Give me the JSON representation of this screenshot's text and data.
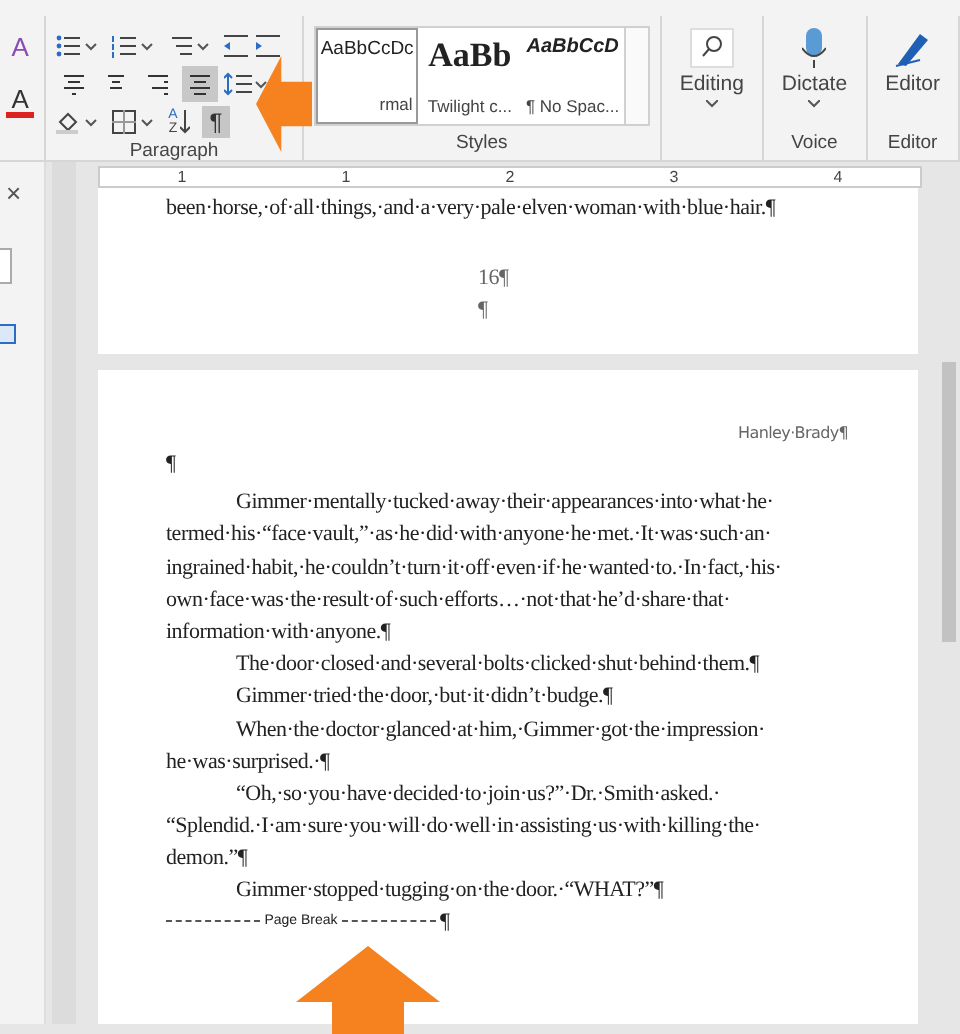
{
  "font_group": {
    "text_effects": "A",
    "font_color": "A"
  },
  "paragraph": {
    "label": "Paragraph",
    "sort": [
      "A",
      "Z"
    ],
    "alignment": [
      {
        "selected": false
      },
      {
        "selected": false
      },
      {
        "selected": false
      },
      {
        "selected": true
      }
    ],
    "show_marks": {
      "label": "¶",
      "selected": true
    }
  },
  "styles": {
    "label": "Styles",
    "items": [
      {
        "preview": "AaBbCcDc",
        "name": "rmal",
        "kind": "normal"
      },
      {
        "preview": "AaBb",
        "name": "Twilight c...",
        "kind": "title"
      },
      {
        "preview": "AaBbCcD",
        "name": "¶ No Spac...",
        "kind": "emphasis"
      }
    ]
  },
  "editing": {
    "label": "Editing"
  },
  "voice": {
    "button": "Dictate",
    "label": "Voice"
  },
  "editor": {
    "button": "Editor",
    "label": "Editor"
  },
  "side_pane": {
    "close": "×",
    "checked": true
  },
  "ruler": {
    "numbers": [
      "1",
      "1",
      "2",
      "3",
      "4"
    ]
  },
  "page_one": [
    {
      "kind": "body",
      "text": "been·horse,·of·all·things,·and·a·very·pale·elven·woman·with·blue·hair.¶"
    },
    {
      "kind": "gap"
    },
    {
      "kind": "center",
      "text": "16¶"
    },
    {
      "kind": "center",
      "text": "¶"
    }
  ],
  "page_two": {
    "header": "Hanley·Brady¶",
    "lines": [
      {
        "kind": "body",
        "text": "¶"
      },
      {
        "kind": "space"
      },
      {
        "kind": "indent",
        "text": "Gimmer·mentally·tucked·away·their·appearances·into·what·he·"
      },
      {
        "kind": "body",
        "text": "termed·his·“face·vault,”·as·he·did·with·anyone·he·met.·It·was·such·an·"
      },
      {
        "kind": "body",
        "text": "ingrained·habit,·he·couldn’t·turn·it·off·even·if·he·wanted·to.·In·fact,·his·"
      },
      {
        "kind": "body",
        "text": "own·face·was·the·result·of·such·efforts…·not·that·he’d·share·that·"
      },
      {
        "kind": "body",
        "text": "information·with·anyone.¶"
      },
      {
        "kind": "indent",
        "text": "The·door·closed·and·several·bolts·clicked·shut·behind·them.¶"
      },
      {
        "kind": "indent",
        "text": "Gimmer·tried·the·door,·but·it·didn’t·budge.¶"
      },
      {
        "kind": "indent",
        "text": "When·the·doctor·glanced·at·him,·Gimmer·got·the·impression·"
      },
      {
        "kind": "body",
        "text": "he·was·surprised.·¶"
      },
      {
        "kind": "indent",
        "text": "“Oh,·so·you·have·decided·to·join·us?”·Dr.·Smith·asked.·"
      },
      {
        "kind": "body",
        "text": "“Splendid.·I·am·sure·you·will·do·well·in·assisting·us·with·killing·the·"
      },
      {
        "kind": "body",
        "text": "demon.”¶"
      },
      {
        "kind": "indent",
        "text": "Gimmer·stopped·tugging·on·the·door.·“WHAT?”¶"
      },
      {
        "kind": "break",
        "text": "Page Break",
        "mark": "¶"
      }
    ]
  }
}
